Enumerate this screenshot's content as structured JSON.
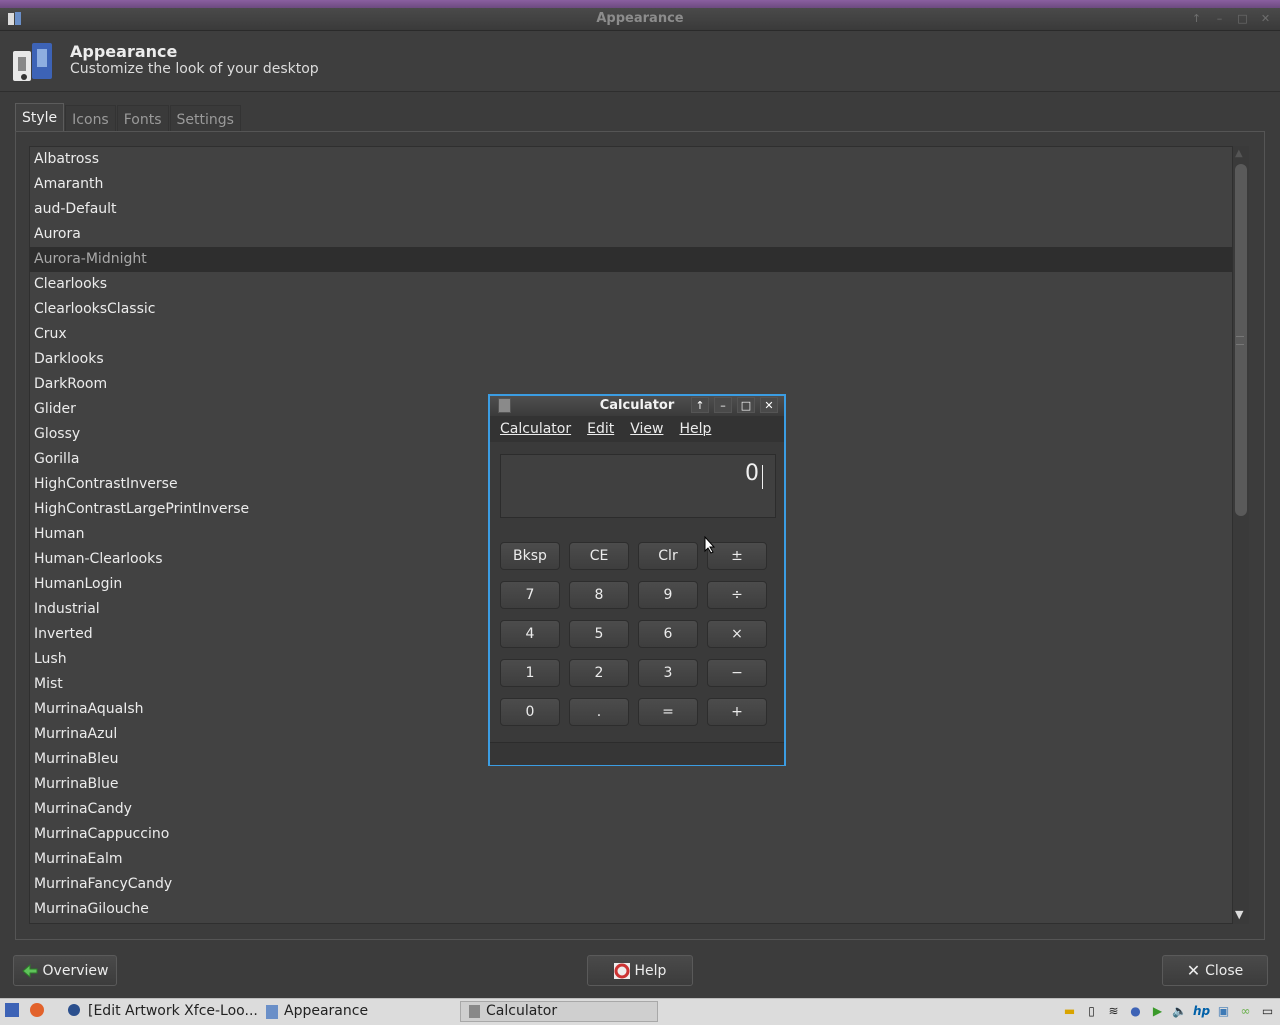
{
  "window": {
    "title": "Appearance"
  },
  "header": {
    "title": "Appearance",
    "subtitle": "Customize the look of your desktop"
  },
  "tabs": [
    {
      "label": "Style",
      "active": true
    },
    {
      "label": "Icons",
      "active": false
    },
    {
      "label": "Fonts",
      "active": false
    },
    {
      "label": "Settings",
      "active": false
    }
  ],
  "themes": {
    "selected": "Aurora-Midnight",
    "items": [
      "Albatross",
      "Amaranth",
      "aud-Default",
      "Aurora",
      "Aurora-Midnight",
      "Clearlooks",
      "ClearlooksClassic",
      "Crux",
      "Darklooks",
      "DarkRoom",
      "Glider",
      "Glossy",
      "Gorilla",
      "HighContrastInverse",
      "HighContrastLargePrintInverse",
      "Human",
      "Human-Clearlooks",
      "HumanLogin",
      "Industrial",
      "Inverted",
      "Lush",
      "Mist",
      "MurrinaAquaIsh",
      "MurrinaAzul",
      "MurrinaBleu",
      "MurrinaBlue",
      "MurrinaCandy",
      "MurrinaCappuccino",
      "MurrinaEalm",
      "MurrinaFancyCandy",
      "MurrinaGilouche"
    ]
  },
  "buttons": {
    "overview": "Overview",
    "help": "Help",
    "close": "Close"
  },
  "calculator": {
    "title": "Calculator",
    "menu": [
      "Calculator",
      "Edit",
      "View",
      "Help"
    ],
    "display": "0",
    "keys": [
      [
        "Bksp",
        "CE",
        "Clr",
        "±"
      ],
      [
        "7",
        "8",
        "9",
        "÷"
      ],
      [
        "4",
        "5",
        "6",
        "×"
      ],
      [
        "1",
        "2",
        "3",
        "−"
      ],
      [
        "0",
        ".",
        "=",
        "+"
      ]
    ]
  },
  "taskbar": {
    "tasks": [
      "[Edit Artwork Xfce-Loo...",
      "Appearance",
      "Calculator"
    ],
    "active": "Calculator"
  },
  "colors": {
    "accent": "#3b9de3",
    "selection_bg": "#2e2e2e"
  }
}
